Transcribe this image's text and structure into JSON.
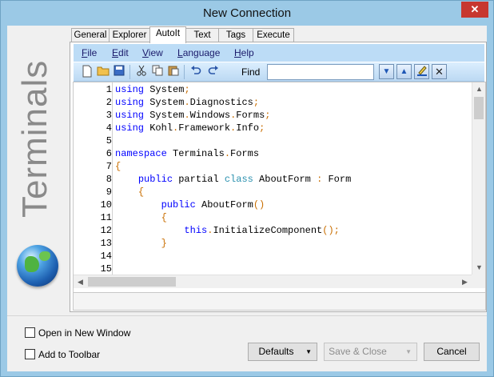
{
  "window": {
    "title": "New Connection",
    "close_glyph": "✕"
  },
  "sidebar": {
    "brand_text": "Terminals",
    "logo_icon": "globe-icon"
  },
  "tabs": [
    {
      "label": "General",
      "active": false
    },
    {
      "label": "Explorer",
      "active": false
    },
    {
      "label": "AutoIt",
      "active": true
    },
    {
      "label": "Text",
      "active": false
    },
    {
      "label": "Tags",
      "active": false
    },
    {
      "label": "Execute",
      "active": false
    }
  ],
  "editor_menu": [
    "File",
    "Edit",
    "View",
    "Language",
    "Help"
  ],
  "toolbar": {
    "find_label": "Find",
    "find_value": "",
    "icons": [
      "new-file-icon",
      "open-folder-icon",
      "save-icon",
      "cut-icon",
      "copy-icon",
      "paste-icon",
      "undo-icon",
      "redo-icon",
      "find-next-icon",
      "find-previous-icon",
      "highlight-icon",
      "clear-icon"
    ]
  },
  "code": {
    "line_numbers": [
      "1",
      "2",
      "3",
      "4",
      "5",
      "6",
      "7",
      "8",
      "9",
      "10",
      "11",
      "12",
      "13",
      "14",
      "15"
    ],
    "lines": [
      [
        [
          "kw",
          "using"
        ],
        [
          "tx",
          " System"
        ],
        [
          "pu",
          ";"
        ]
      ],
      [
        [
          "kw",
          "using"
        ],
        [
          "tx",
          " System"
        ],
        [
          "pu",
          "."
        ],
        [
          "tx",
          "Diagnostics"
        ],
        [
          "pu",
          ";"
        ]
      ],
      [
        [
          "kw",
          "using"
        ],
        [
          "tx",
          " System"
        ],
        [
          "pu",
          "."
        ],
        [
          "tx",
          "Windows"
        ],
        [
          "pu",
          "."
        ],
        [
          "tx",
          "Forms"
        ],
        [
          "pu",
          ";"
        ]
      ],
      [
        [
          "kw",
          "using"
        ],
        [
          "tx",
          " Kohl"
        ],
        [
          "pu",
          "."
        ],
        [
          "tx",
          "Framework"
        ],
        [
          "pu",
          "."
        ],
        [
          "tx",
          "Info"
        ],
        [
          "pu",
          ";"
        ]
      ],
      [],
      [
        [
          "kw",
          "namespace"
        ],
        [
          "tx",
          " Terminals"
        ],
        [
          "pu",
          "."
        ],
        [
          "tx",
          "Forms"
        ]
      ],
      [
        [
          "pu",
          "{"
        ]
      ],
      [
        [
          "tx",
          "    "
        ],
        [
          "kw",
          "public"
        ],
        [
          "tx",
          " partial "
        ],
        [
          "ty",
          "class"
        ],
        [
          "tx",
          " AboutForm "
        ],
        [
          "pu",
          ":"
        ],
        [
          "tx",
          " Form"
        ]
      ],
      [
        [
          "tx",
          "    "
        ],
        [
          "pu",
          "{"
        ]
      ],
      [
        [
          "tx",
          "        "
        ],
        [
          "kw",
          "public"
        ],
        [
          "tx",
          " AboutForm"
        ],
        [
          "pu",
          "()"
        ]
      ],
      [
        [
          "tx",
          "        "
        ],
        [
          "pu",
          "{"
        ]
      ],
      [
        [
          "tx",
          "            "
        ],
        [
          "kw",
          "this"
        ],
        [
          "pu",
          "."
        ],
        [
          "tx",
          "InitializeComponent"
        ],
        [
          "pu",
          "();"
        ]
      ],
      [
        [
          "tx",
          "        "
        ],
        [
          "pu",
          "}"
        ]
      ],
      [],
      []
    ]
  },
  "options": {
    "open_new_window": {
      "label": "Open in New Window",
      "checked": false
    },
    "add_toolbar": {
      "label": "Add to Toolbar",
      "checked": false
    }
  },
  "buttons": {
    "defaults": "Defaults",
    "save_close": "Save & Close",
    "cancel": "Cancel"
  }
}
